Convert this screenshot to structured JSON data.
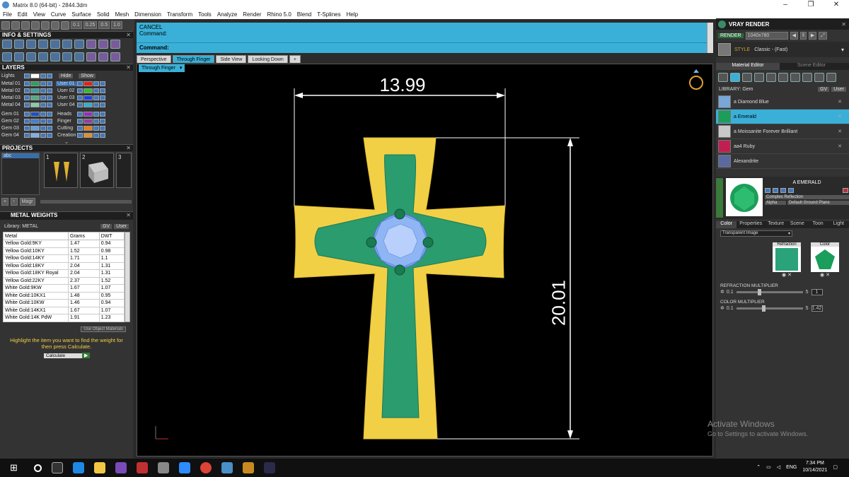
{
  "window": {
    "title": "Matrix 8.0 (64-bit) - 2844.3dm"
  },
  "menu": [
    "File",
    "Edit",
    "View",
    "Curve",
    "Surface",
    "Solid",
    "Mesh",
    "Dimension",
    "Transform",
    "Tools",
    "Analyze",
    "Render",
    "Rhino 5.0",
    "Blend",
    "T-Splines",
    "Help"
  ],
  "toolbar": {
    "v1": "0.1",
    "v2": "0.25",
    "v3": "0.5",
    "v4": "1.0"
  },
  "info_settings": {
    "title": "INFO & SETTINGS"
  },
  "layers": {
    "title": "LAYERS",
    "lights_label": "Lights",
    "hide_label": "Hide",
    "show_label": "Show",
    "rows": [
      {
        "name": "Metal 01",
        "color": "#2e9e5a",
        "user": "User 01",
        "ucolor": "#e02020"
      },
      {
        "name": "Metal 02",
        "color": "#3aa0a0",
        "user": "User 02",
        "ucolor": "#30c030"
      },
      {
        "name": "Metal 03",
        "color": "#55aa88",
        "user": "User 03",
        "ucolor": "#2040e0"
      },
      {
        "name": "Metal 04",
        "color": "#88ccaa",
        "user": "User 04",
        "ucolor": "#30b0d0"
      }
    ],
    "rows2": [
      {
        "name": "Gem 01",
        "color": "#2050c0",
        "user": "Heads",
        "ucolor": "#9030c0"
      },
      {
        "name": "Gem 02",
        "color": "#4080d0",
        "user": "Finger",
        "ucolor": "#9040a0"
      },
      {
        "name": "Gem 03",
        "color": "#60a0e0",
        "user": "Cutting",
        "ucolor": "#e08020"
      },
      {
        "name": "Gem 04",
        "color": "#80b0e8",
        "user": "Creation",
        "ucolor": "#e09030"
      }
    ]
  },
  "projects": {
    "title": "PROJECTS",
    "item": "abc",
    "thumbs": [
      "1",
      "2",
      "3"
    ],
    "btn_magr": "Magr"
  },
  "metal_weights": {
    "title": "METAL WEIGHTS",
    "library": "Library: METAL",
    "gv": "GV",
    "user": "User",
    "headers": [
      "Metal",
      "Grams",
      "DWT"
    ],
    "rows": [
      [
        "Yellow Gold:9KY",
        "1.47",
        "0.94"
      ],
      [
        "Yellow Gold:10KY",
        "1.52",
        "0.98"
      ],
      [
        "Yellow Gold:14KY",
        "1.71",
        "1.1"
      ],
      [
        "Yellow Gold:18KY",
        "2.04",
        "1.31"
      ],
      [
        "Yellow Gold:18KY Royal",
        "2.04",
        "1.31"
      ],
      [
        "Yellow Gold:22KY",
        "2.37",
        "1.52"
      ],
      [
        "White Gold:9KW",
        "1.67",
        "1.07"
      ],
      [
        "White Gold:10KX1",
        "1.48",
        "0.95"
      ],
      [
        "White Gold:10KW",
        "1.46",
        "0.94"
      ],
      [
        "White Gold:14KX1",
        "1.67",
        "1.07"
      ],
      [
        "White Gold:14K PdW",
        "1.91",
        "1.23"
      ]
    ],
    "use_object": "Use Object Materials",
    "hint": "Highlight the item you want to find the weight for then press Calculate.",
    "calculate": "Calculate"
  },
  "command": {
    "cancel": "CANCEL",
    "line2": "Command:",
    "prompt": "Command:"
  },
  "tabs": [
    "Perspective",
    "Through Finger",
    "Side View",
    "Looking Down",
    "+"
  ],
  "viewport": {
    "label": "Through Finger",
    "dim_width": "13.99",
    "dim_height": "20.01"
  },
  "vray": {
    "title": "VRAY RENDER",
    "render": "RENDER",
    "size": "1040x780",
    "style_label": "STYLE",
    "style": "Classic - (Fast)",
    "tab1": "Material Editor",
    "tab2": "Scene Editor",
    "library": "LIBRARY: Gem",
    "gv": "GV",
    "user": "User",
    "materials": [
      {
        "name": "a Diamond Blue",
        "color": "#7aa6d8"
      },
      {
        "name": "a Emerald",
        "color": "#1b9e5a"
      },
      {
        "name": "a Moissanite Forever Brilliant",
        "color": "#c8c8c8"
      },
      {
        "name": "aa4 Ruby",
        "color": "#c02050"
      },
      {
        "name": "Alexandrite",
        "color": "#5a6aa0"
      }
    ],
    "selected_name": "A EMERALD",
    "complex": "Complex Reflection",
    "alpha": "Alpha",
    "ground": "Default Ground Plane",
    "subtabs": [
      "Color",
      "Properties",
      "Texture",
      "Scene",
      "Toon",
      "Light"
    ],
    "transparent": "Transparent Image",
    "refraction": "Refraction",
    "color": "Color",
    "refr_mult": "REFRACTION MULTIPLIER",
    "refr_min": "0.1",
    "refr_max": "5",
    "refr_val": "1",
    "color_mult": "COLOR MULTIPLIER",
    "col_min": "0.1",
    "col_max": "5",
    "col_val": "1.42"
  },
  "watermark": {
    "line1": "Activate Windows",
    "line2": "Go to Settings to activate Windows."
  },
  "taskbar": {
    "lang": "ENG",
    "time": "7:34 PM",
    "date": "10/14/2021"
  },
  "colors": {
    "accent": "#3ab0d8",
    "gold": "#f2d046",
    "green": "#2a9c6e"
  }
}
